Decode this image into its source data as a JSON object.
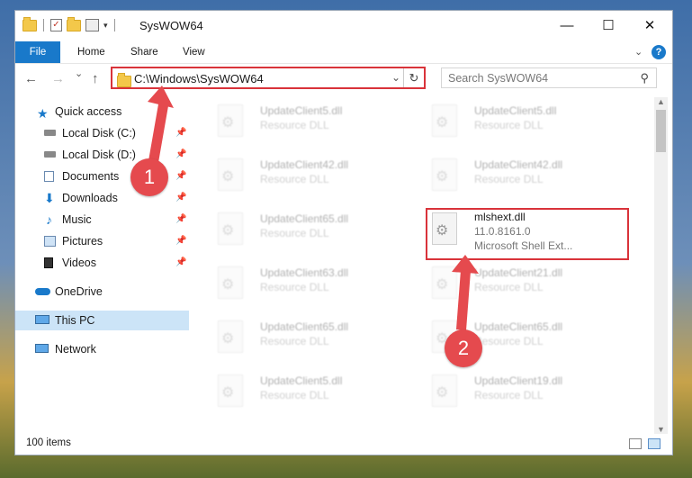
{
  "window": {
    "title": "SysWOW64",
    "controls": {
      "minimize": "—",
      "maximize": "☐",
      "close": "✕"
    }
  },
  "ribbon": {
    "tabs": [
      "File",
      "Home",
      "Share",
      "View"
    ],
    "expand_icon": "chevron-down-icon",
    "help_icon": "?"
  },
  "navigation": {
    "back": "←",
    "forward": "→",
    "recent": "⌄",
    "up": "↑",
    "address": "C:\\Windows\\SysWOW64",
    "search_placeholder": "Search SysWOW64"
  },
  "sidebar": {
    "items": [
      {
        "label": "Quick access",
        "icon": "star-icon"
      },
      {
        "label": "Local Disk (C:)",
        "icon": "drive-icon",
        "pinned": true
      },
      {
        "label": "Local Disk (D:)",
        "icon": "drive-icon",
        "pinned": true
      },
      {
        "label": "Documents",
        "icon": "documents-icon",
        "pinned": true
      },
      {
        "label": "Downloads",
        "icon": "downloads-icon",
        "pinned": true
      },
      {
        "label": "Music",
        "icon": "music-icon",
        "pinned": true
      },
      {
        "label": "Pictures",
        "icon": "pictures-icon",
        "pinned": true
      },
      {
        "label": "Videos",
        "icon": "videos-icon",
        "pinned": true
      },
      {
        "label": "OneDrive",
        "icon": "cloud-icon"
      },
      {
        "label": "This PC",
        "icon": "computer-icon",
        "selected": true
      },
      {
        "label": "Network",
        "icon": "network-icon"
      }
    ]
  },
  "files": {
    "left_column": [
      {
        "name": "UpdateClient5.dll",
        "type": "Resource DLL"
      },
      {
        "name": "UpdateClient42.dll",
        "type": "Resource DLL"
      },
      {
        "name": "UpdateClient65.dll",
        "type": "Resource DLL"
      },
      {
        "name": "UpdateClient63.dll",
        "type": "Resource DLL"
      },
      {
        "name": "UpdateClient65.dll",
        "type": "Resource DLL"
      },
      {
        "name": "UpdateClient5.dll",
        "type": "Resource DLL"
      }
    ],
    "right_column": [
      {
        "name": "UpdateClient5.dll",
        "type": "Resource DLL"
      },
      {
        "name": "UpdateClient42.dll",
        "type": "Resource DLL"
      },
      {
        "name": "mlshext.dll",
        "version": "11.0.8161.0",
        "description": "Microsoft Shell Ext..."
      },
      {
        "name": "UpdateClient21.dll",
        "type": "Resource DLL"
      },
      {
        "name": "UpdateClient65.dll",
        "type": "Resource DLL"
      },
      {
        "name": "UpdateClient19.dll",
        "type": "Resource DLL"
      }
    ]
  },
  "status": {
    "item_count": "100 items"
  },
  "annotations": {
    "badge_1": "1",
    "badge_2": "2",
    "color": "#d9333a"
  }
}
